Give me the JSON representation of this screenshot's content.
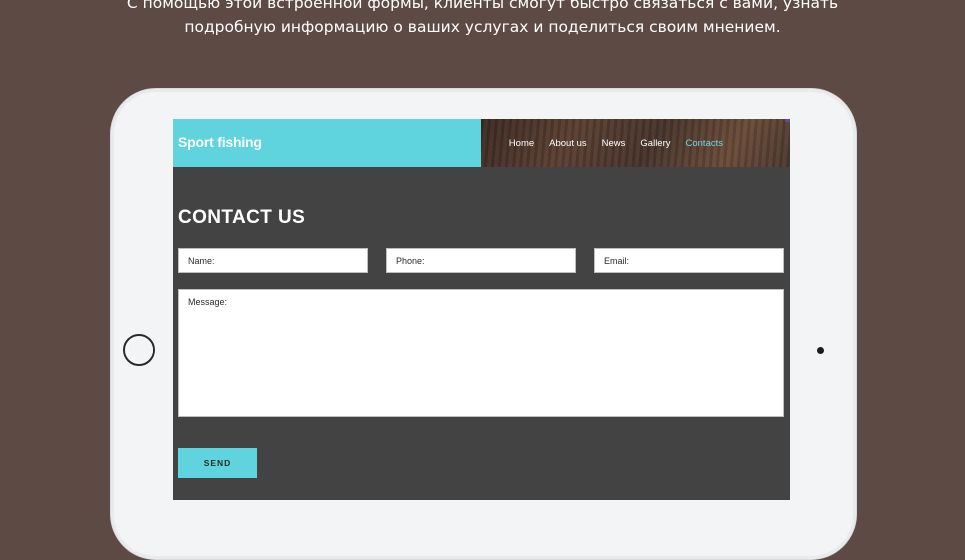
{
  "intro": {
    "line1": "С помощью этой встроенной формы, клиенты смогут быстро связаться с вами, узнать",
    "line2": "подробную информацию о ваших услугах и поделиться своим мнением."
  },
  "site": {
    "brand": "Sport fishing",
    "nav": [
      "Home",
      "About us",
      "News",
      "Gallery",
      "Contacts"
    ],
    "active_nav": "Contacts"
  },
  "contact": {
    "title": "CONTACT US",
    "fields": {
      "name_placeholder": "Name:",
      "phone_placeholder": "Phone:",
      "email_placeholder": "Email:",
      "message_placeholder": "Message:"
    },
    "send_label": "SEND"
  },
  "colors": {
    "page_background": "#5e4a44",
    "accent": "#5fd3de",
    "screen_background": "#434343"
  }
}
